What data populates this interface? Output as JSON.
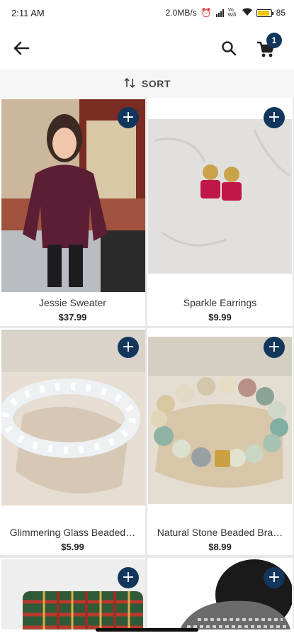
{
  "status": {
    "time": "2:11 AM",
    "net_speed": "2.0MB/s",
    "vowifi": "Vo Wifi",
    "battery": "85"
  },
  "appbar": {
    "back_icon": "back-arrow-icon",
    "search_icon": "search-icon",
    "cart_icon": "cart-icon",
    "cart_count": "1"
  },
  "sort": {
    "label": "SORT",
    "icon": "sort-arrows-icon"
  },
  "products": [
    {
      "name": "Jessie Sweater",
      "price": "$37.99"
    },
    {
      "name": "Sparkle Earrings",
      "price": "$9.99"
    },
    {
      "name": "Glimmering Glass Beaded…",
      "price": "$5.99"
    },
    {
      "name": "Natural Stone Beaded Bra…",
      "price": "$8.99"
    },
    {
      "name": "",
      "price": ""
    },
    {
      "name": "",
      "price": ""
    }
  ],
  "colors": {
    "accent": "#12365c"
  }
}
